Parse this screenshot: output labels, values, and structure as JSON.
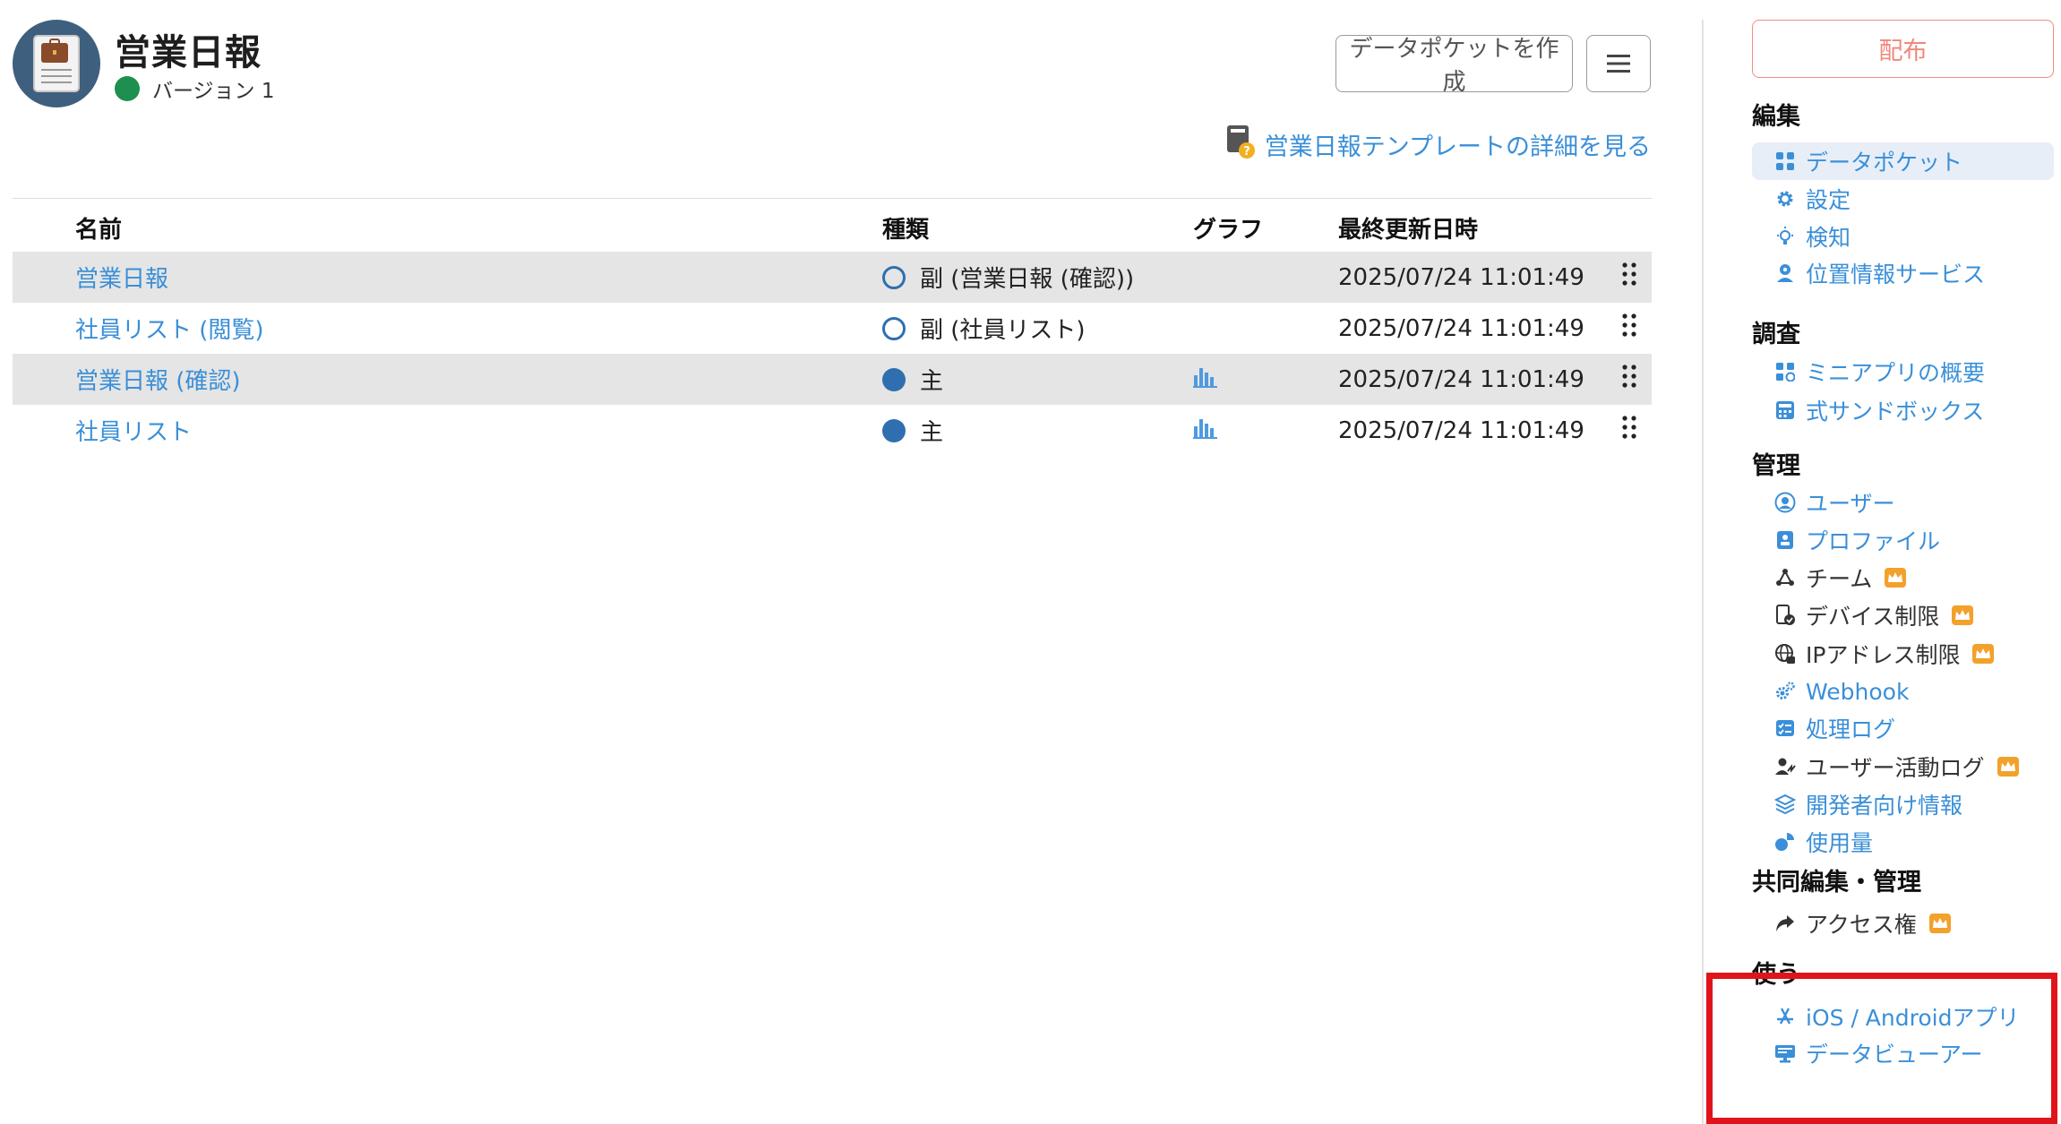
{
  "header": {
    "title": "営業日報",
    "version": "バージョン 1",
    "create_button": "データポケットを作成",
    "template_link": "営業日報テンプレートの詳細を見る"
  },
  "table": {
    "columns": [
      "名前",
      "種類",
      "グラフ",
      "最終更新日時"
    ],
    "rows": [
      {
        "name": "営業日報",
        "type": "副 (営業日報 (確認))",
        "type_kind": "sub",
        "graph": false,
        "updated": "2025/07/24 11:01:49"
      },
      {
        "name": "社員リスト (閲覧)",
        "type": "副 (社員リスト)",
        "type_kind": "sub",
        "graph": false,
        "updated": "2025/07/24 11:01:49"
      },
      {
        "name": "営業日報 (確認)",
        "type": "主",
        "type_kind": "main",
        "graph": true,
        "updated": "2025/07/24 11:01:49"
      },
      {
        "name": "社員リスト",
        "type": "主",
        "type_kind": "main",
        "graph": true,
        "updated": "2025/07/24 11:01:49"
      }
    ]
  },
  "sidebar": {
    "distribute_button": "配布",
    "sections": [
      {
        "title": "編集",
        "items": [
          {
            "label": "データポケット",
            "icon": "grid-icon",
            "active": true
          },
          {
            "label": "設定",
            "icon": "gear-icon"
          },
          {
            "label": "検知",
            "icon": "lightbulb-icon"
          },
          {
            "label": "位置情報サービス",
            "icon": "location-person-icon"
          }
        ]
      },
      {
        "title": "調査",
        "items": [
          {
            "label": "ミニアプリの概要",
            "icon": "apps-icon"
          },
          {
            "label": "式サンドボックス",
            "icon": "calculator-icon"
          }
        ]
      },
      {
        "title": "管理",
        "items": [
          {
            "label": "ユーザー",
            "icon": "user-circle-icon"
          },
          {
            "label": "プロファイル",
            "icon": "profile-card-icon"
          },
          {
            "label": "チーム",
            "icon": "team-icon",
            "premium": true
          },
          {
            "label": "デバイス制限",
            "icon": "device-check-icon",
            "premium": true
          },
          {
            "label": "IPアドレス制限",
            "icon": "globe-lock-icon",
            "premium": true
          },
          {
            "label": "Webhook",
            "icon": "gears-icon"
          },
          {
            "label": "処理ログ",
            "icon": "checklist-icon"
          },
          {
            "label": "ユーザー活動ログ",
            "icon": "user-activity-icon",
            "premium": true
          },
          {
            "label": "開発者向け情報",
            "icon": "layers-icon"
          },
          {
            "label": "使用量",
            "icon": "usage-chart-icon"
          }
        ]
      },
      {
        "title": "共同編集・管理",
        "items": [
          {
            "label": "アクセス権",
            "icon": "share-arrow-icon",
            "premium": true
          }
        ]
      },
      {
        "title": "使う",
        "items": [
          {
            "label": "iOS / Androidアプリ",
            "icon": "app-store-icon"
          },
          {
            "label": "データビューアー",
            "icon": "monitor-icon"
          }
        ]
      }
    ]
  },
  "colors": {
    "link": "#3a8fd8",
    "version_dot": "#1e8f4e",
    "type_mark": "#2f6fb0",
    "premium_badge": "#f2a12b",
    "distribute": "#f0877c",
    "highlight": "#e0141a"
  }
}
